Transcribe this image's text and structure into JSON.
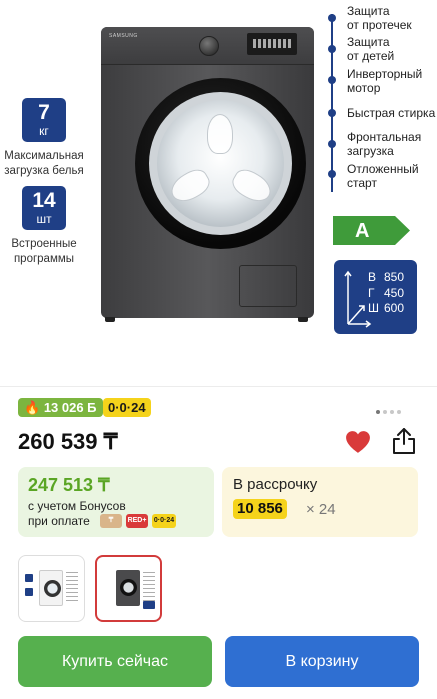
{
  "specs": [
    {
      "value": "7",
      "unit": "кг",
      "caption_line1": "Максимальная",
      "caption_line2": "загрузка белья"
    },
    {
      "value": "14",
      "unit": "шт",
      "caption_line1": "Встроенные",
      "caption_line2": "программы"
    }
  ],
  "washer": {
    "brand": "SAMSUNG"
  },
  "features": [
    {
      "line1": "Защита",
      "line2": "от протечек"
    },
    {
      "line1": "Защита",
      "line2": "от детей"
    },
    {
      "line1": "Инверторный",
      "line2": "мотор"
    },
    {
      "line1": "Быстрая стирка",
      "line2": ""
    },
    {
      "line1": "Фронтальная",
      "line2": "загрузка"
    },
    {
      "line1": "Отложенный",
      "line2": "старт"
    }
  ],
  "energy_class": "A",
  "dimensions": {
    "height_key": "В",
    "height": "850",
    "depth_key": "Г",
    "depth": "450",
    "width_key": "Ш",
    "width": "600"
  },
  "badges": {
    "bonus": "13 026 Б",
    "installment_plan": "0·0·24"
  },
  "pager": {
    "count": 4,
    "active": 0
  },
  "price": "260 539 ₸",
  "bonus_box": {
    "price": "247 513 ₸",
    "note_line1": "с учетом Бонусов",
    "note_line2": "при оплате",
    "pay_icons": [
      "RED+",
      "0·0·24"
    ]
  },
  "installment_box": {
    "title": "В рассрочку",
    "amount": "10 856",
    "multiplier": "× 24"
  },
  "buttons": {
    "buy_now": "Купить сейчас",
    "add_to_cart": "В корзину"
  },
  "colors": {
    "brand_blue": "#1f3f86",
    "green": "#56b04e",
    "blue_button": "#2f6fd2",
    "yellow": "#f5d31b",
    "heart_red": "#d93a3a",
    "energy_green": "#3f9b3a"
  }
}
